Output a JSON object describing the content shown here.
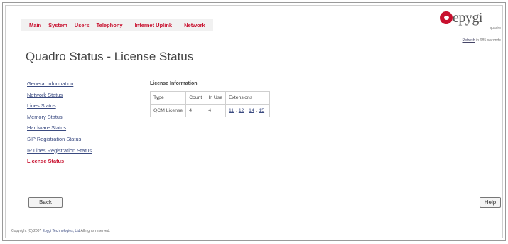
{
  "nav": {
    "items": [
      "Main",
      "System",
      "Users",
      "Telephony",
      "Internet Uplink",
      "Network"
    ]
  },
  "logo": {
    "text": "epygi",
    "sub": "quadro"
  },
  "refresh": {
    "link": "Refresh",
    "text": " in 985 seconds"
  },
  "page_title": "Quadro Status - License Status",
  "sidebar": {
    "items": [
      {
        "label": "General Information",
        "active": false
      },
      {
        "label": "Network Status",
        "active": false
      },
      {
        "label": "Lines Status",
        "active": false
      },
      {
        "label": "Memory Status",
        "active": false
      },
      {
        "label": "Hardware Status",
        "active": false
      },
      {
        "label": "SIP Registration Status",
        "active": false
      },
      {
        "label": "IP Lines Registration Status",
        "active": false
      },
      {
        "label": "License Status",
        "active": true
      }
    ]
  },
  "license": {
    "section_title": "License Information",
    "headers": [
      "Type",
      "Count",
      "In Use",
      "Extensions"
    ],
    "rows": [
      {
        "type": "QCM License",
        "count": "4",
        "in_use": "4",
        "extensions": [
          "11",
          "12",
          "14",
          "15"
        ]
      }
    ]
  },
  "buttons": {
    "back": "Back",
    "help": "Help"
  },
  "copyright": {
    "prefix": "Copyright (C) 2007 ",
    "link": "Epygi Technologies, Ltd",
    "suffix": " All rights reserved."
  },
  "colors": {
    "accent": "#c8102e",
    "link": "#3a4a80"
  }
}
